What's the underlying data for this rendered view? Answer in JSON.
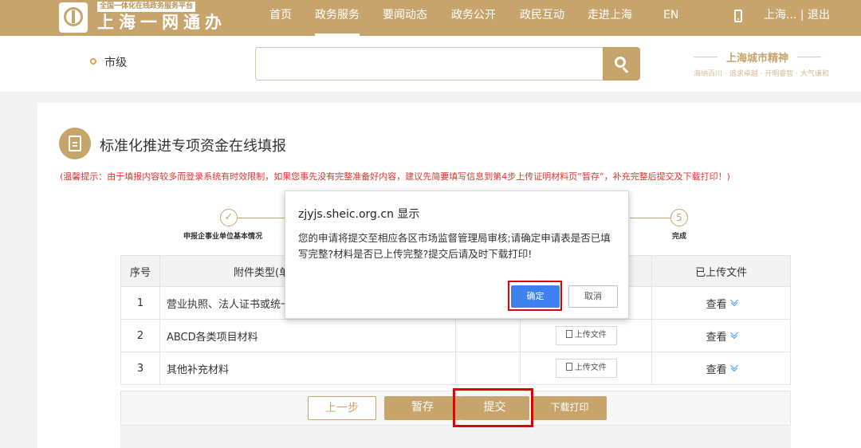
{
  "header": {
    "brand_tag": "全国一体化在线政务服务平台",
    "brand_name": "上海一网通办",
    "nav": [
      "首页",
      "政务服务",
      "要闻动态",
      "政务公开",
      "政民互动",
      "走进上海",
      "EN"
    ],
    "active_nav": "政务服务",
    "user_links": "上海... | 退出",
    "brand_color": "#c8a46d"
  },
  "search": {
    "location": "市级",
    "query": ""
  },
  "spirit": {
    "title": "上海城市精神",
    "subtitle": "海纳百川 · 追求卓越 · 开明睿智 · 大气谦和"
  },
  "page": {
    "title": "标准化推进专项资金在线填报",
    "notice": "(温馨提示：由于填报内容较多而登录系统有时效限制，如果您事先没有完整准备好内容，建议先简要填写信息到第4步上传证明材料页“暂存”，补充完整后提交及下载打印！)"
  },
  "steps": {
    "first_label": "申报企事业单位基本情况",
    "last_number": "5",
    "last_label": "完成"
  },
  "table": {
    "headers": {
      "num": "序号",
      "type": "附件类型(单",
      "uploaded": "已上传文件"
    },
    "rows": [
      {
        "num": "1",
        "type": "营业执照、法人证书或统一",
        "upload": "",
        "view": "查看"
      },
      {
        "num": "2",
        "type": "ABCD各类项目材料",
        "upload": "上传文件",
        "view": "查看"
      },
      {
        "num": "3",
        "type": "其他补充材料",
        "upload": "上传文件",
        "view": "查看"
      }
    ]
  },
  "buttons": {
    "prev": "上一步",
    "save": "暂存",
    "submit": "提交",
    "print": "下载打印"
  },
  "dialog": {
    "title": "zjyjs.sheic.org.cn 显示",
    "message": "您的申请将提交至相应各区市场监督管理局审核;请确定申请表是否已填写完整?材料是否已上传完整?提交后请及时下载打印!",
    "ok": "确定",
    "cancel": "取消"
  }
}
